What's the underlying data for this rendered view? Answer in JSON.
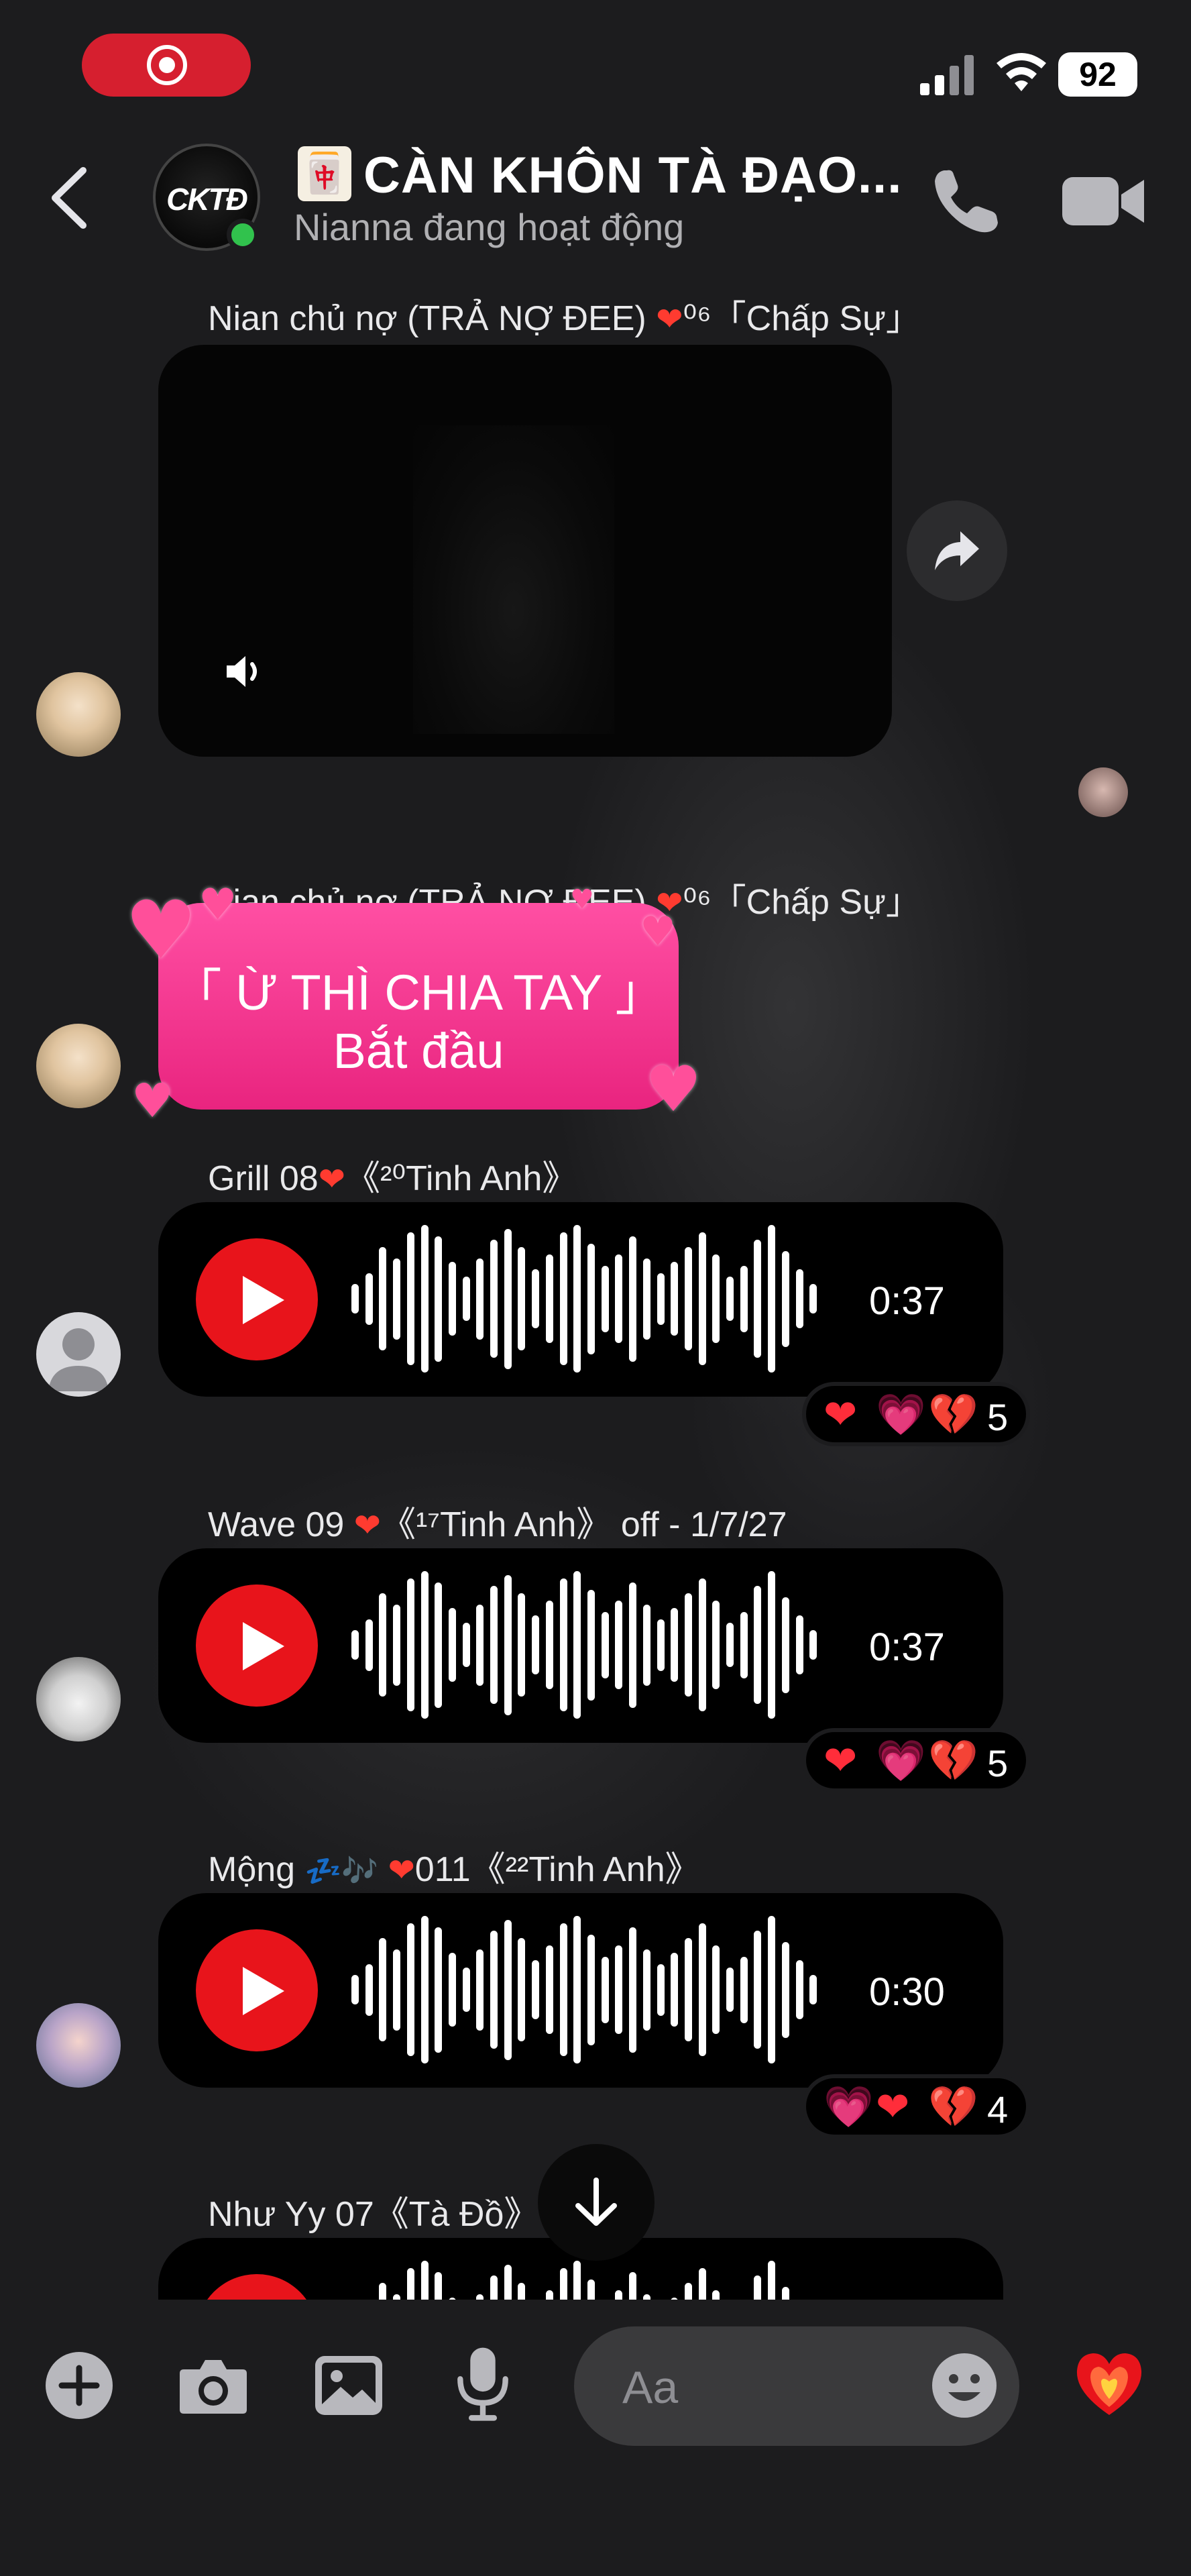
{
  "status_bar": {
    "battery": "92"
  },
  "header": {
    "group_logo": "CKTĐ",
    "title_emoji": "🀄",
    "title": "CÀN KHÔN TÀ ĐẠO...",
    "status": "Nianna đang hoạt động"
  },
  "messages": [
    {
      "sender": "Nian chủ nợ (TRẢ NỢ ĐEE)",
      "sender_suffix": "⁰⁶「Chấp Sự」",
      "type": "video"
    },
    {
      "sender": "Nian chủ nợ (TRẢ NỢ ĐEE)",
      "sender_suffix": "⁰⁶「Chấp Sự」",
      "type": "text",
      "line1": "「 Ừ THÌ CHIA TAY 」",
      "line2": "Bắt đầu"
    },
    {
      "sender": "Grill 08",
      "sender_suffix": "《²⁰Tinh Anh》",
      "type": "voice",
      "duration": "0:37",
      "reactions": [
        "❤",
        "💗",
        "💔"
      ],
      "reaction_count": "5"
    },
    {
      "sender": "Wave 09",
      "sender_suffix": "《¹⁷Tinh Anh》 off - 1/7/27",
      "type": "voice",
      "duration": "0:37",
      "reactions": [
        "❤",
        "💗",
        "💔"
      ],
      "reaction_count": "5"
    },
    {
      "sender": "Mộng",
      "sender_mid": "💤🎶",
      "sender_suffix": "011《²²Tinh Anh》",
      "type": "voice",
      "duration": "0:30",
      "reactions": [
        "💗",
        "❤",
        "💔"
      ],
      "reaction_count": "4"
    },
    {
      "sender": "Như Yy 07《Tà Đồ》",
      "type": "voice"
    }
  ],
  "composer": {
    "placeholder": "Aa"
  },
  "icons": {
    "back": "chevron-left-icon",
    "call": "phone-icon",
    "video": "video-camera-icon",
    "add": "plus-circle-icon",
    "camera": "camera-icon",
    "gallery": "photo-icon",
    "mic": "microphone-icon",
    "emoji": "smiley-icon",
    "like": "fire-heart-icon"
  },
  "colors": {
    "accent_red": "#e8141b",
    "pink_bubble": "#ff4fa3",
    "background": "#1c1c1e",
    "online": "#31c24d"
  }
}
